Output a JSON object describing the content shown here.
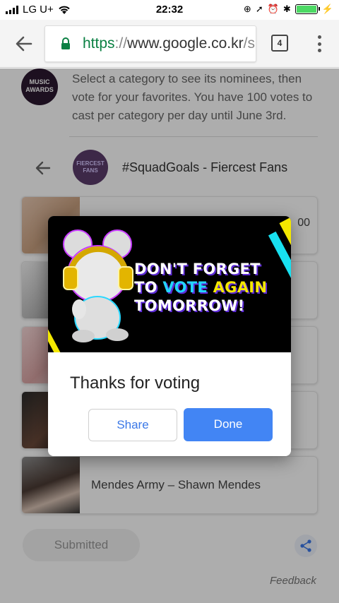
{
  "status_bar": {
    "carrier": "LG U+",
    "time": "22:32",
    "icons": [
      "signal-icon",
      "wifi-icon",
      "orientation-lock-icon",
      "location-icon",
      "alarm-icon",
      "bluetooth-icon",
      "battery-icon",
      "charging-icon"
    ]
  },
  "browser": {
    "url_scheme": "https",
    "url_slashes": "://",
    "url_host": "www.google.co.kr",
    "url_tail": "/s",
    "tab_count": "4",
    "colors": {
      "scheme": "#0b8043",
      "lock": "#0b8043"
    }
  },
  "page": {
    "intro_text": "Select a category to see its nominees, then vote for your favorites. You have 100 votes to cast per category per day until June 3rd.",
    "award_logo_text": "MUSIC AWARDS",
    "category": {
      "logo_text": "FIERCEST FANS",
      "title": "#SquadGoals - Fiercest Fans"
    },
    "nominees": [
      {
        "label": "",
        "count": "00"
      },
      {
        "label": "",
        "count": ""
      },
      {
        "label": "",
        "count": ""
      },
      {
        "label": "",
        "count": ""
      },
      {
        "label": "Mendes Army – Shawn Mendes",
        "count": ""
      }
    ],
    "submitted_label": "Submitted",
    "feedback_label": "Feedback"
  },
  "dialog": {
    "banner": {
      "line1": "DON'T FORGET",
      "line2_a": "TO ",
      "line2_b": "VOTE ",
      "line2_c": "AGAIN",
      "line3": "TOMORROW!"
    },
    "title": "Thanks for voting",
    "share_label": "Share",
    "done_label": "Done",
    "colors": {
      "primary": "#4285f4"
    }
  }
}
